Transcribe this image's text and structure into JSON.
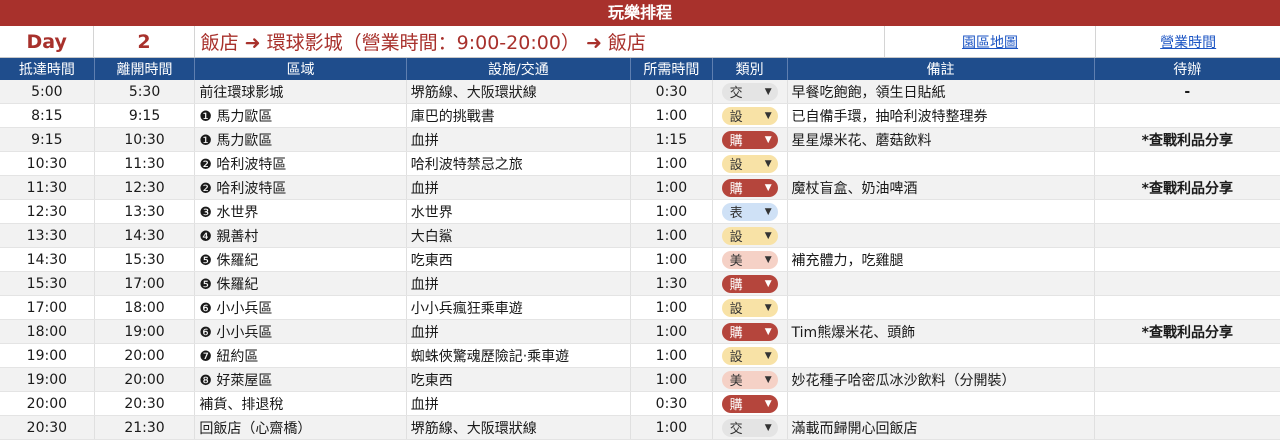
{
  "title": "玩樂排程",
  "day": {
    "label": "Day",
    "number": "2",
    "route": "飯店 ➜ 環球影城（營業時間：9:00-20:00） ➜ 飯店",
    "link_map": "園區地圖",
    "link_hours": "營業時間"
  },
  "headers": [
    "抵達時間",
    "離開時間",
    "區域",
    "設施/交通",
    "所需時間",
    "類別",
    "備註",
    "待辦"
  ],
  "rows": [
    {
      "arrive": "5:00",
      "leave": "5:30",
      "area": "前往環球影城",
      "facility": "堺筋線、大阪環狀線",
      "duration": "0:30",
      "category": "交",
      "note": "早餐吃飽飽，領生日貼紙",
      "todo": "-"
    },
    {
      "arrive": "8:15",
      "leave": "9:15",
      "area": "❶ 馬力歐區",
      "facility": "庫巴的挑戰書",
      "duration": "1:00",
      "category": "設",
      "note": "已自備手環，抽哈利波特整理券",
      "todo": ""
    },
    {
      "arrive": "9:15",
      "leave": "10:30",
      "area": "❶ 馬力歐區",
      "facility": "血拼",
      "duration": "1:15",
      "category": "購",
      "note": "星星爆米花、蘑菇飲料",
      "todo": "*查戰利品分享"
    },
    {
      "arrive": "10:30",
      "leave": "11:30",
      "area": "❷ 哈利波特區",
      "facility": "哈利波特禁忌之旅",
      "duration": "1:00",
      "category": "設",
      "note": "",
      "todo": ""
    },
    {
      "arrive": "11:30",
      "leave": "12:30",
      "area": "❷ 哈利波特區",
      "facility": "血拼",
      "duration": "1:00",
      "category": "購",
      "note": "魔杖盲盒、奶油啤酒",
      "todo": "*查戰利品分享"
    },
    {
      "arrive": "12:30",
      "leave": "13:30",
      "area": "❸ 水世界",
      "facility": "水世界",
      "duration": "1:00",
      "category": "表",
      "note": "",
      "todo": ""
    },
    {
      "arrive": "13:30",
      "leave": "14:30",
      "area": "❹ 親善村",
      "facility": "大白鯊",
      "duration": "1:00",
      "category": "設",
      "note": "",
      "todo": ""
    },
    {
      "arrive": "14:30",
      "leave": "15:30",
      "area": "❺ 侏羅紀",
      "facility": "吃東西",
      "duration": "1:00",
      "category": "美",
      "note": "補充體力，吃雞腿",
      "todo": ""
    },
    {
      "arrive": "15:30",
      "leave": "17:00",
      "area": "❺ 侏羅紀",
      "facility": "血拼",
      "duration": "1:30",
      "category": "購",
      "note": "",
      "todo": ""
    },
    {
      "arrive": "17:00",
      "leave": "18:00",
      "area": "❻ 小小兵區",
      "facility": "小小兵瘋狂乘車遊",
      "duration": "1:00",
      "category": "設",
      "note": "",
      "todo": ""
    },
    {
      "arrive": "18:00",
      "leave": "19:00",
      "area": "❻ 小小兵區",
      "facility": "血拼",
      "duration": "1:00",
      "category": "購",
      "note": "Tim熊爆米花、頭飾",
      "todo": "*查戰利品分享"
    },
    {
      "arrive": "19:00",
      "leave": "20:00",
      "area": "❼ 紐約區",
      "facility": "蜘蛛俠驚魂歷險記‧乘車遊",
      "duration": "1:00",
      "category": "設",
      "note": "",
      "todo": ""
    },
    {
      "arrive": "19:00",
      "leave": "20:00",
      "area": "❽ 好萊屋區",
      "facility": "吃東西",
      "duration": "1:00",
      "category": "美",
      "note": "妙花種子哈密瓜冰沙飲料（分開裝）",
      "todo": ""
    },
    {
      "arrive": "20:00",
      "leave": "20:30",
      "area": "補貨、排退稅",
      "facility": "血拼",
      "duration": "0:30",
      "category": "購",
      "note": "",
      "todo": ""
    },
    {
      "arrive": "20:30",
      "leave": "21:30",
      "area": "回飯店（心齋橋）",
      "facility": "堺筋線、大阪環狀線",
      "duration": "1:00",
      "category": "交",
      "note": "滿載而歸開心回飯店",
      "todo": ""
    }
  ],
  "category_colors": {
    "交": "#e4e4e4",
    "設": "#f8e2a6",
    "購": "#b5453c",
    "表": "#cfe1f6",
    "美": "#f5d1c6"
  }
}
